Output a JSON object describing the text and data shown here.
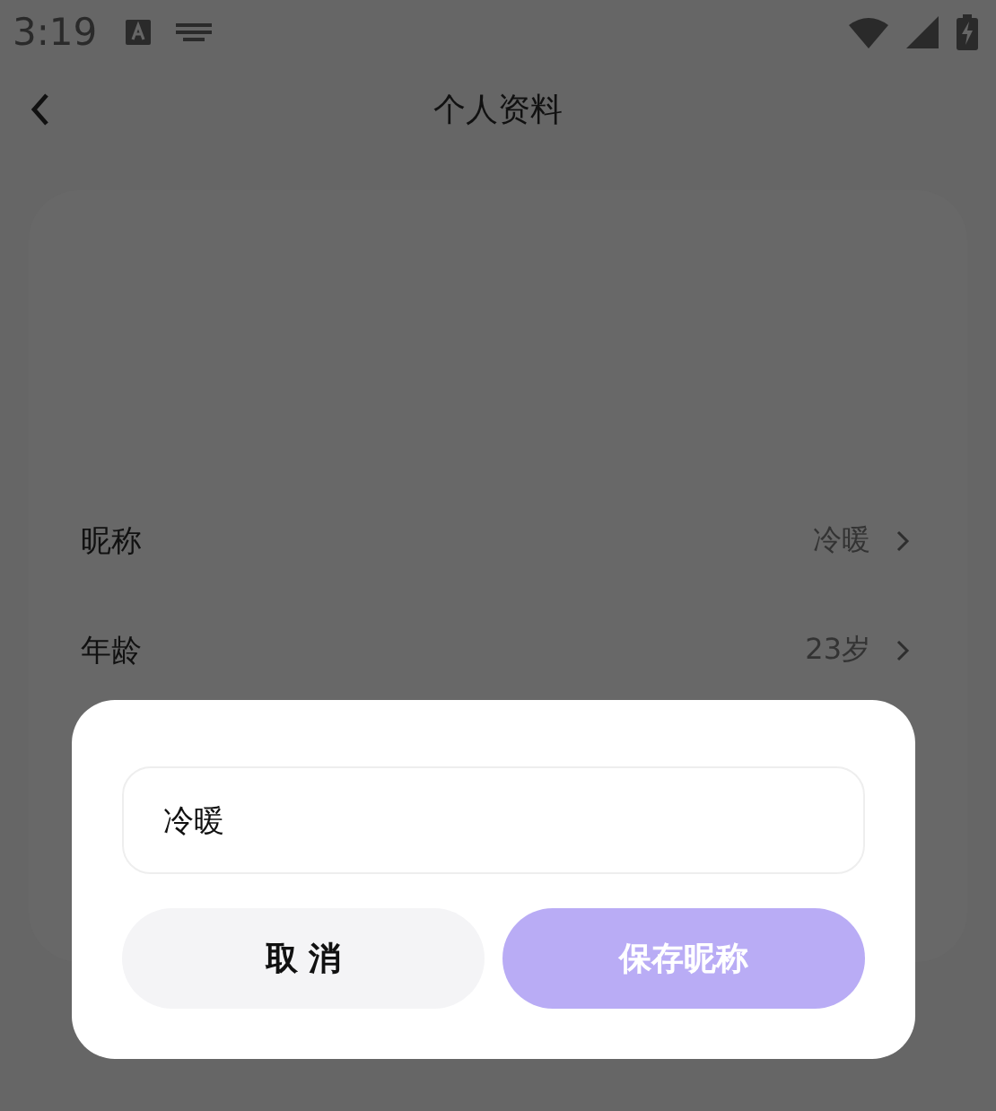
{
  "status_bar": {
    "time": "3:19"
  },
  "header": {
    "title": "个人资料"
  },
  "profile_rows": [
    {
      "label": "昵称",
      "value": "冷暖"
    },
    {
      "label": "年龄",
      "value": "23岁"
    }
  ],
  "dialog": {
    "input": {
      "value": "冷暖"
    },
    "buttons": [
      {
        "label": "取 消",
        "kind": "cancel",
        "disabled": false
      },
      {
        "label": "保存昵称",
        "kind": "confirm",
        "disabled": true
      }
    ]
  }
}
